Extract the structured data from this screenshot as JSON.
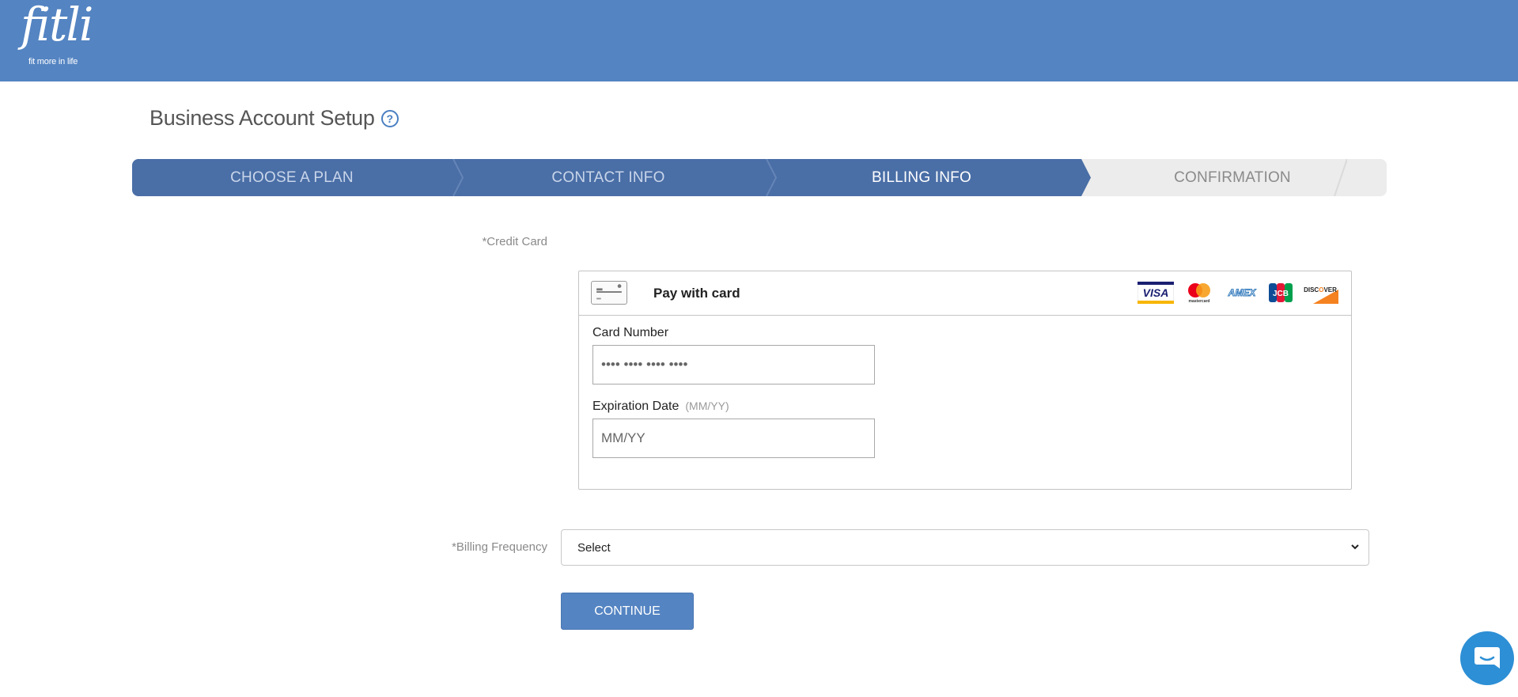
{
  "brand": {
    "name": "fitli",
    "tagline": "fit more in life",
    "color": "#5484c2"
  },
  "page": {
    "title": "Business Account Setup",
    "help_icon": "question-circle-icon"
  },
  "steps": [
    {
      "label": "CHOOSE A PLAN",
      "state": "done"
    },
    {
      "label": "CONTACT INFO",
      "state": "done"
    },
    {
      "label": "BILLING INFO",
      "state": "active"
    },
    {
      "label": "CONFIRMATION",
      "state": "todo"
    }
  ],
  "credit_card": {
    "label": "*Credit Card",
    "pay_title": "Pay with card",
    "card_icon": "credit-card-icon",
    "brands": [
      "VISA",
      "mastercard",
      "AMEX",
      "JCB",
      "DISCOVER"
    ],
    "card_number": {
      "label": "Card Number",
      "placeholder": "•••• •••• •••• ••••"
    },
    "expiration": {
      "label": "Expiration Date",
      "hint": "(MM/YY)",
      "placeholder": "MM/YY"
    }
  },
  "billing_frequency": {
    "label": "*Billing Frequency",
    "selected": "Select"
  },
  "continue_label": "CONTINUE",
  "chat_icon": "chat-bubble-icon"
}
